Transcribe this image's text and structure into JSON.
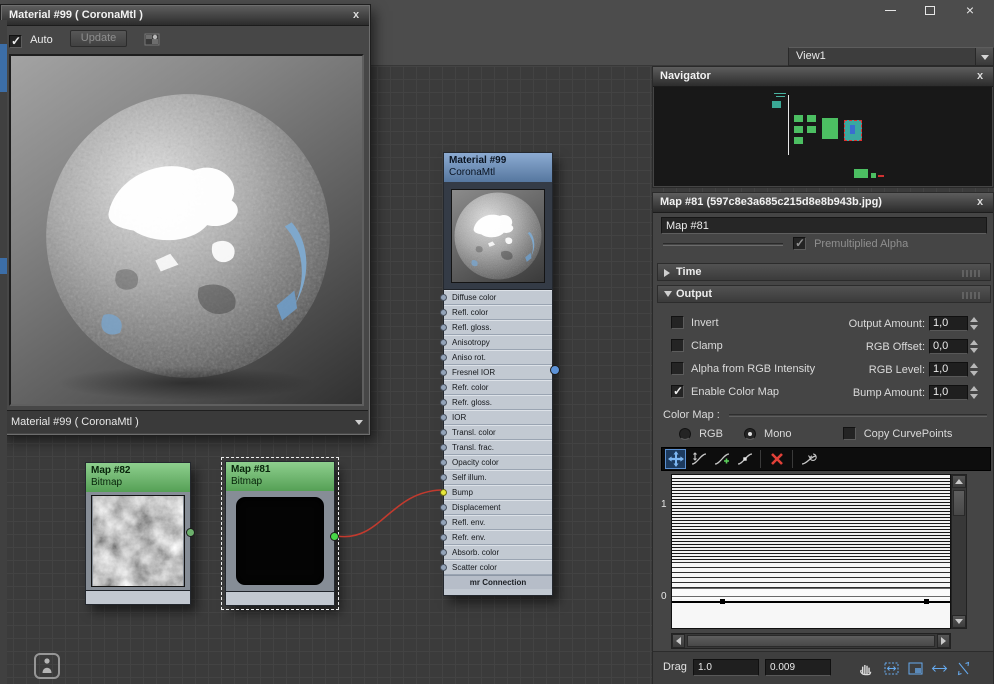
{
  "material_window": {
    "title": "Material #99  ( CoronaMtl )",
    "auto": "Auto",
    "update": "Update",
    "footer_dropdown": "Material #99  ( CoronaMtl )"
  },
  "chrome": {
    "view_dropdown": "View1"
  },
  "navigator": {
    "title": "Navigator"
  },
  "map_panel": {
    "title": "Map #81 (597c8e3a685c215d8e8b943b.jpg)",
    "map_name": "Map #81",
    "premultiplied_alpha": "Premultiplied Alpha",
    "time_rollout": "Time",
    "output_rollout": "Output",
    "invert": "Invert",
    "clamp": "Clamp",
    "alpha_from_rgb": "Alpha from RGB Intensity",
    "enable_color_map": "Enable Color Map",
    "output_amount_label": "Output Amount:",
    "output_amount_value": "1,0",
    "rgb_offset_label": "RGB Offset:",
    "rgb_offset_value": "0,0",
    "rgb_level_label": "RGB Level:",
    "rgb_level_value": "1,0",
    "bump_amount_label": "Bump Amount:",
    "bump_amount_value": "1,0",
    "color_map_label": "Color Map :",
    "rgb_radio": "RGB",
    "mono_radio": "Mono",
    "copy_curvepoints": "Copy CurvePoints",
    "axis_one": "1",
    "axis_zero": "0",
    "drag_label": "Drag",
    "drag_value_1": "1.0",
    "drag_value_2": "0.009"
  },
  "nodes": {
    "material": {
      "title": "Material #99",
      "subtitle": "CoronaMtl",
      "slots": [
        "Diffuse color",
        "Refl. color",
        "Refl. gloss.",
        "Anisotropy",
        "Aniso rot.",
        "Fresnel IOR",
        "Refr. color",
        "Refr. gloss.",
        "IOR",
        "Transl. color",
        "Transl. frac.",
        "Opacity color",
        "Self illum.",
        "Bump",
        "Displacement",
        "Refl. env.",
        "Refr. env.",
        "Absorb. color",
        "Scatter color"
      ],
      "footer": "mr Connection"
    },
    "map82": {
      "title": "Map #82",
      "subtitle": "Bitmap"
    },
    "map81": {
      "title": "Map #81",
      "subtitle": "Bitmap"
    }
  },
  "colors": {
    "node_header_blue": "#6f92bd",
    "node_header_green": "#6fb46f",
    "wire_red": "#c23a2e",
    "bump_socket_yellow": "#e6e63c",
    "output_socket_green": "#47d647",
    "output_socket_blue": "#5d93d8"
  }
}
